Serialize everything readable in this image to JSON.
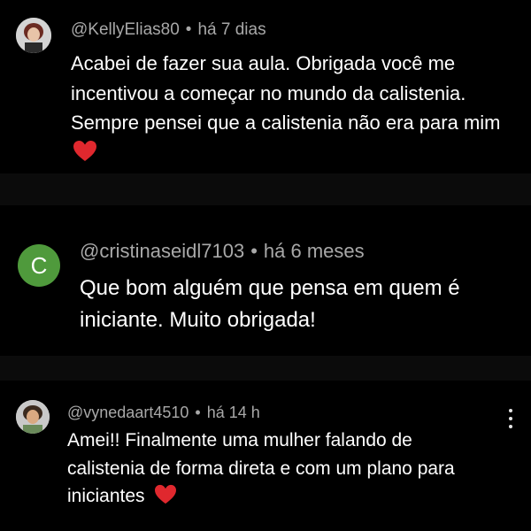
{
  "comments": [
    {
      "username": "@KellyElias80",
      "separator": "•",
      "time": "há 7 dias",
      "text": "Acabei de fazer sua aula. Obrigada você me incentivou a começar no mundo da calistenia. Sempre pensei que a calistenia não era para mim",
      "avatar": "photo"
    },
    {
      "username": "@cristinaseidl7103",
      "separator": "•",
      "time": "há 6 meses",
      "text": "Que bom alguém que pensa em quem é iniciante. Muito obrigada!",
      "avatar": "initial",
      "avatar_letter": "C",
      "avatar_color": "#4f9a3c"
    },
    {
      "username": "@vynedaart4510",
      "separator": "•",
      "time": "há 14 h",
      "text": "Amei!! Finalmente uma mulher falando de calistenia de forma direta e com um plano para iniciantes",
      "avatar": "photo",
      "menu_icon": "more-vertical-icon"
    }
  ],
  "colors": {
    "background": "#000000",
    "separator_band": "#0b0b0b",
    "meta_text": "#a8a8a8",
    "body_text": "#ffffff",
    "heart": "#e0282e"
  },
  "icons": {
    "heart": "red-heart-icon"
  }
}
